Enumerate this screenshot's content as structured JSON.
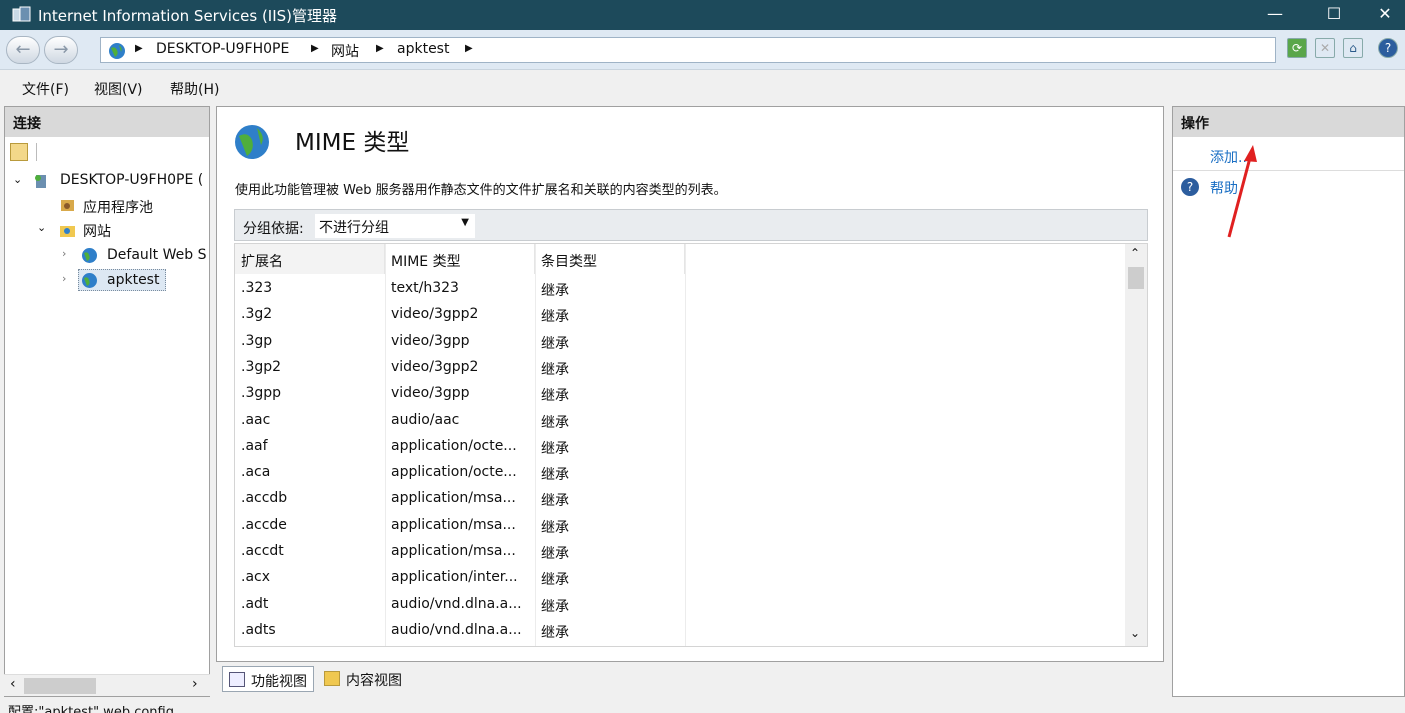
{
  "window": {
    "title": "Internet Information Services (IIS)管理器",
    "minimize": "—",
    "maximize": "☐",
    "close": "✕"
  },
  "address": {
    "crumbs": [
      "DESKTOP-U9FH0PE",
      "网站",
      "apktest"
    ],
    "back": "←",
    "forward": "→"
  },
  "menu": {
    "items": [
      "文件(F)",
      "视图(V)",
      "帮助(H)"
    ]
  },
  "connections": {
    "header": "连接",
    "tree": [
      {
        "label": "DESKTOP-U9FH0PE ("
      },
      {
        "label": "应用程序池"
      },
      {
        "label": "网站"
      },
      {
        "label": "Default Web S"
      },
      {
        "label": "apktest"
      }
    ]
  },
  "feature": {
    "title": "MIME 类型",
    "description": "使用此功能管理被 Web 服务器用作静态文件的文件扩展名和关联的内容类型的列表。",
    "group_label": "分组依据:",
    "group_value": "不进行分组",
    "columns": [
      "扩展名",
      "MIME 类型",
      "条目类型"
    ],
    "rows": [
      {
        "ext": ".323",
        "mime": "text/h323",
        "type": "继承"
      },
      {
        "ext": ".3g2",
        "mime": "video/3gpp2",
        "type": "继承"
      },
      {
        "ext": ".3gp",
        "mime": "video/3gpp",
        "type": "继承"
      },
      {
        "ext": ".3gp2",
        "mime": "video/3gpp2",
        "type": "继承"
      },
      {
        "ext": ".3gpp",
        "mime": "video/3gpp",
        "type": "继承"
      },
      {
        "ext": ".aac",
        "mime": "audio/aac",
        "type": "继承"
      },
      {
        "ext": ".aaf",
        "mime": "application/octe...",
        "type": "继承"
      },
      {
        "ext": ".aca",
        "mime": "application/octe...",
        "type": "继承"
      },
      {
        "ext": ".accdb",
        "mime": "application/msa...",
        "type": "继承"
      },
      {
        "ext": ".accde",
        "mime": "application/msa...",
        "type": "继承"
      },
      {
        "ext": ".accdt",
        "mime": "application/msa...",
        "type": "继承"
      },
      {
        "ext": ".acx",
        "mime": "application/inter...",
        "type": "继承"
      },
      {
        "ext": ".adt",
        "mime": "audio/vnd.dlna.a...",
        "type": "继承"
      },
      {
        "ext": ".adts",
        "mime": "audio/vnd.dlna.a...",
        "type": "继承"
      }
    ]
  },
  "views": {
    "feature_view": "功能视图",
    "content_view": "内容视图"
  },
  "actions": {
    "header": "操作",
    "add": "添加...",
    "help": "帮助"
  },
  "status": {
    "text": "配置:\"apktest\" web.config"
  },
  "colors": {
    "titlebar": "#1d4a5b",
    "link": "#1a6fc4",
    "arrow": "#e02020",
    "selection": "#dde8f3"
  }
}
